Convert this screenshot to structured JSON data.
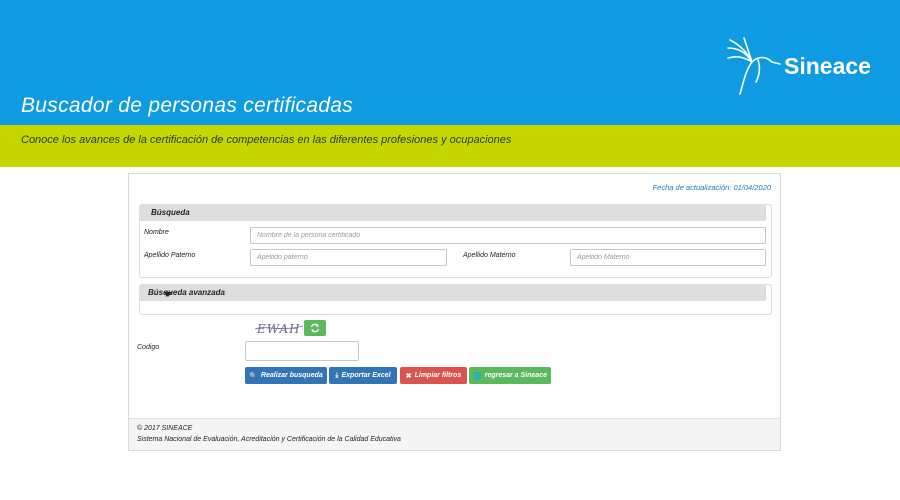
{
  "header": {
    "title": "Buscador de personas certificadas",
    "subtitle": "Conoce los avances de la certificación de competencias en las diferentes profesiones y ocupaciones",
    "logo_text": "Sineace",
    "colors": {
      "blue": "#0e9be2",
      "green": "#c6d600"
    }
  },
  "panel": {
    "update_date": "Fecha de actualización: 01/04/2020",
    "search": {
      "heading": "Búsqueda",
      "nombre_label": "Nombre",
      "nombre_placeholder": "Nombre de la persona certificado",
      "paterno_label": "Apellido Paterno",
      "paterno_placeholder": "Apellido paterno",
      "materno_label": "Apellido Materno",
      "materno_placeholder": "Apellido Materno"
    },
    "advanced": {
      "heading": "Búsqueda avanzada",
      "icon": "caret-down-icon"
    },
    "captcha": {
      "label": "Codigo",
      "image_text": "EWAH",
      "refresh_icon": "refresh-icon"
    },
    "buttons": {
      "search": "Realizar busqueda",
      "export": "Exportar Excel",
      "clear": "Limpiar filtros",
      "back": "regresar a Sineace"
    }
  },
  "footer": {
    "copyright": "© 2017 SINEACE",
    "org": "Sistema Nacional de Evaluación, Acreditación y Certificación de la Calidad Educativa"
  }
}
